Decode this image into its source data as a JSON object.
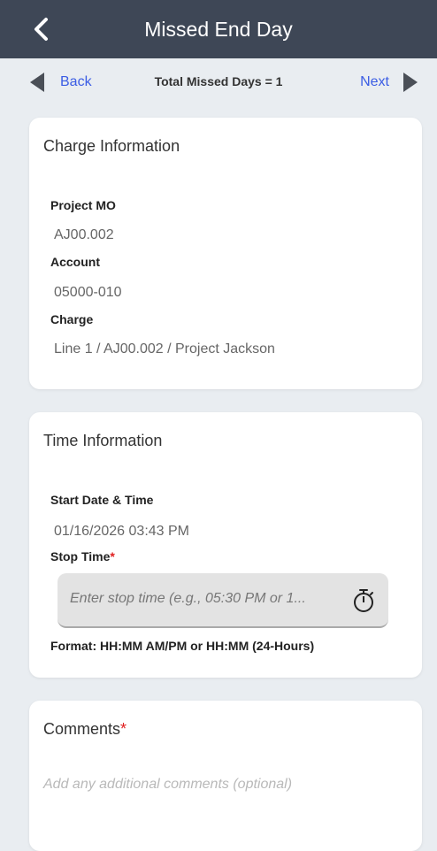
{
  "header": {
    "title": "Missed End Day"
  },
  "subnav": {
    "back_label": "Back",
    "next_label": "Next",
    "missed_text": "Total Missed Days = 1"
  },
  "charge": {
    "title": "Charge Information",
    "project_label": "Project MO",
    "project_value": "AJ00.002",
    "account_label": "Account",
    "account_value": "05000-010",
    "charge_label": "Charge",
    "charge_value": "Line 1 / AJ00.002 / Project Jackson"
  },
  "time": {
    "title": "Time Information",
    "start_label": "Start Date & Time",
    "start_value": "01/16/2026 03:43 PM",
    "stop_label": "Stop Time",
    "stop_required": "*",
    "stop_placeholder": "Enter stop time (e.g., 05:30 PM or 1...",
    "format_hint": "Format: HH:MM AM/PM or HH:MM (24-Hours)"
  },
  "comments": {
    "title": "Comments",
    "required": "*",
    "placeholder": "Add any additional comments (optional)"
  },
  "icons": {
    "back": "chevron-left-icon",
    "timer": "stopwatch-icon"
  },
  "colors": {
    "header_bg": "#3e4756",
    "link": "#3b5de4",
    "required": "#e02020"
  }
}
